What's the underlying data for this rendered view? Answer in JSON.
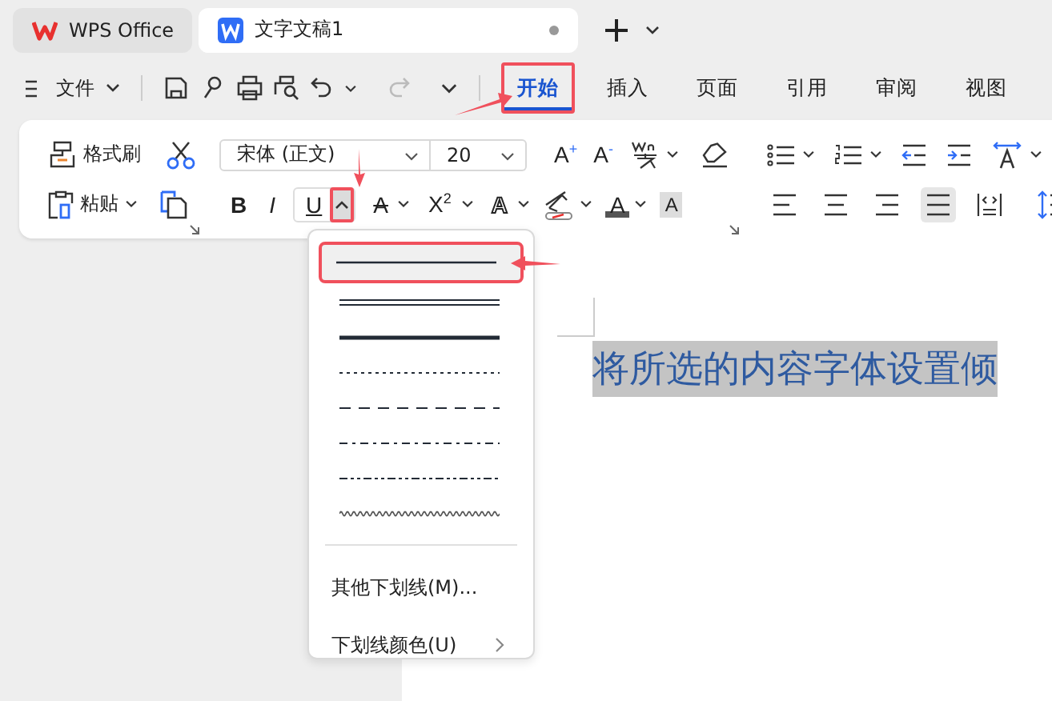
{
  "tabs": [
    {
      "label": "WPS Office",
      "kind": "home",
      "selected": false
    },
    {
      "label": "文字文稿1",
      "kind": "doc",
      "selected": true
    }
  ],
  "menu": {
    "file": "文件",
    "ribbon_tabs": [
      {
        "label": "开始",
        "selected": true,
        "callout": true
      },
      {
        "label": "插入",
        "selected": false,
        "callout": false
      },
      {
        "label": "页面",
        "selected": false,
        "callout": false
      },
      {
        "label": "引用",
        "selected": false,
        "callout": false
      },
      {
        "label": "审阅",
        "selected": false,
        "callout": false
      },
      {
        "label": "视图",
        "selected": false,
        "callout": false
      }
    ]
  },
  "ribbon": {
    "format_painter": "格式刷",
    "paste": "粘贴",
    "font_family": "宋体 (正文)",
    "font_size": "20",
    "row1": [
      {
        "kind": "grow",
        "glyph": "A$^{+}$"
      },
      {
        "kind": "shrink",
        "glyph": "A$^{-}$"
      }
    ],
    "row2": [
      {
        "kind": "bold",
        "glyph": "B",
        "caret": false
      },
      {
        "kind": "italic",
        "glyph": "I",
        "caret": false
      },
      {
        "kind": "underline",
        "glyph": "U",
        "caret": true,
        "callout": true
      },
      {
        "kind": "strike",
        "glyph": "A",
        "caret": true
      },
      {
        "kind": "superscript",
        "glyph": "X$^{2}$",
        "caret": true
      },
      {
        "kind": "effect",
        "glyph": "A",
        "caret": true
      },
      {
        "kind": "highlight",
        "caret": true
      },
      {
        "kind": "color",
        "glyph": "A",
        "caret": true
      },
      {
        "kind": "shade",
        "glyph": "A",
        "caret": false
      }
    ],
    "align": [
      {
        "kind": "left",
        "selected": false
      },
      {
        "kind": "center",
        "selected": false
      },
      {
        "kind": "right",
        "selected": false
      },
      {
        "kind": "justify",
        "selected": true
      },
      {
        "kind": "distributed",
        "selected": false
      }
    ]
  },
  "underline_menu": {
    "styles": [
      {
        "kind": "single",
        "selected": true,
        "callout": true
      },
      {
        "kind": "double",
        "selected": false,
        "callout": false
      },
      {
        "kind": "thick",
        "selected": false,
        "callout": false
      },
      {
        "kind": "dotted",
        "selected": false,
        "callout": false
      },
      {
        "kind": "dashed",
        "selected": false,
        "callout": false
      },
      {
        "kind": "dash-dot",
        "selected": false,
        "callout": false
      },
      {
        "kind": "dash-dot-dot",
        "selected": false,
        "callout": false
      },
      {
        "kind": "wavy",
        "selected": false,
        "callout": false
      }
    ],
    "items": [
      {
        "label": "其他下划线(M)...",
        "submenu": false
      },
      {
        "label": "下划线颜色(U)",
        "submenu": true
      }
    ]
  },
  "document": {
    "text": "将所选的内容字体设置倾"
  }
}
